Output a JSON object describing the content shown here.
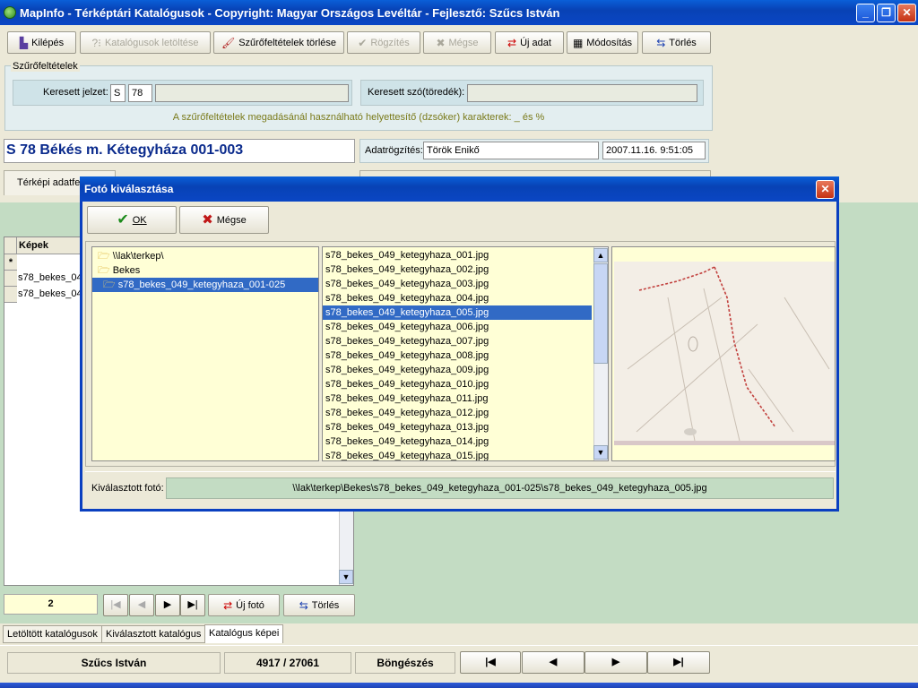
{
  "window": {
    "title": "MapInfo - Térképtári Katalógusok - Copyright: Magyar Országos Levéltár - Fejlesztő: Szűcs István"
  },
  "toolbar": {
    "exit": "Kilépés",
    "download": "Katalógusok letöltése",
    "clear_filters": "Szűrőfeltételek törlése",
    "save": "Rögzítés",
    "cancel": "Mégse",
    "new": "Új adat",
    "modify": "Módosítás",
    "delete": "Törlés"
  },
  "filters": {
    "group_label": "Szűrőfeltételek",
    "code_label": "Keresett jelzet:",
    "code_prefix": "S",
    "code_number": "78",
    "code_rest": "",
    "word_label": "Keresett szó(töredék):",
    "word_value": "",
    "hint": "A szűrőfeltételek megadásánál használható helyettesítő (dzsóker) karakterek: _ és %"
  },
  "record": {
    "title": "S 78 Békés m. Kétegyháza 001-003",
    "recorded_label": "Adatrögzítés:",
    "recorded_by": "Török Enikő",
    "recorded_at": "2007.11.16. 9:51:05"
  },
  "left_tab": "Térképi adatfe",
  "images_grid": {
    "header": "Képek",
    "new_row_marker": "*",
    "rows": [
      "s78_bekes_04",
      "s78_bekes_04"
    ],
    "count": "2",
    "new_photo": "Új fotó",
    "delete": "Törlés"
  },
  "bottom_tabs": [
    "Letöltött katalógusok",
    "Kiválasztott katalógus",
    "Katalógus képei"
  ],
  "status": {
    "user": "Szűcs István",
    "position": "4917 / 27061",
    "mode": "Böngészés"
  },
  "dialog": {
    "title": "Fotó kiválasztása",
    "ok": "OK",
    "cancel": "Mégse",
    "folders": [
      "\\\\lak\\terkep\\",
      "Bekes",
      "s78_bekes_049_ketegyhaza_001-025"
    ],
    "files": [
      "s78_bekes_049_ketegyhaza_001.jpg",
      "s78_bekes_049_ketegyhaza_002.jpg",
      "s78_bekes_049_ketegyhaza_003.jpg",
      "s78_bekes_049_ketegyhaza_004.jpg",
      "s78_bekes_049_ketegyhaza_005.jpg",
      "s78_bekes_049_ketegyhaza_006.jpg",
      "s78_bekes_049_ketegyhaza_007.jpg",
      "s78_bekes_049_ketegyhaza_008.jpg",
      "s78_bekes_049_ketegyhaza_009.jpg",
      "s78_bekes_049_ketegyhaza_010.jpg",
      "s78_bekes_049_ketegyhaza_011.jpg",
      "s78_bekes_049_ketegyhaza_012.jpg",
      "s78_bekes_049_ketegyhaza_013.jpg",
      "s78_bekes_049_ketegyhaza_014.jpg",
      "s78_bekes_049_ketegyhaza_015.jpg"
    ],
    "selected_index": 4,
    "selected_label": "Kiválasztott fotó:",
    "selected_path": "\\\\lak\\terkep\\Bekes\\s78_bekes_049_ketegyhaza_001-025\\s78_bekes_049_ketegyhaza_005.jpg"
  }
}
